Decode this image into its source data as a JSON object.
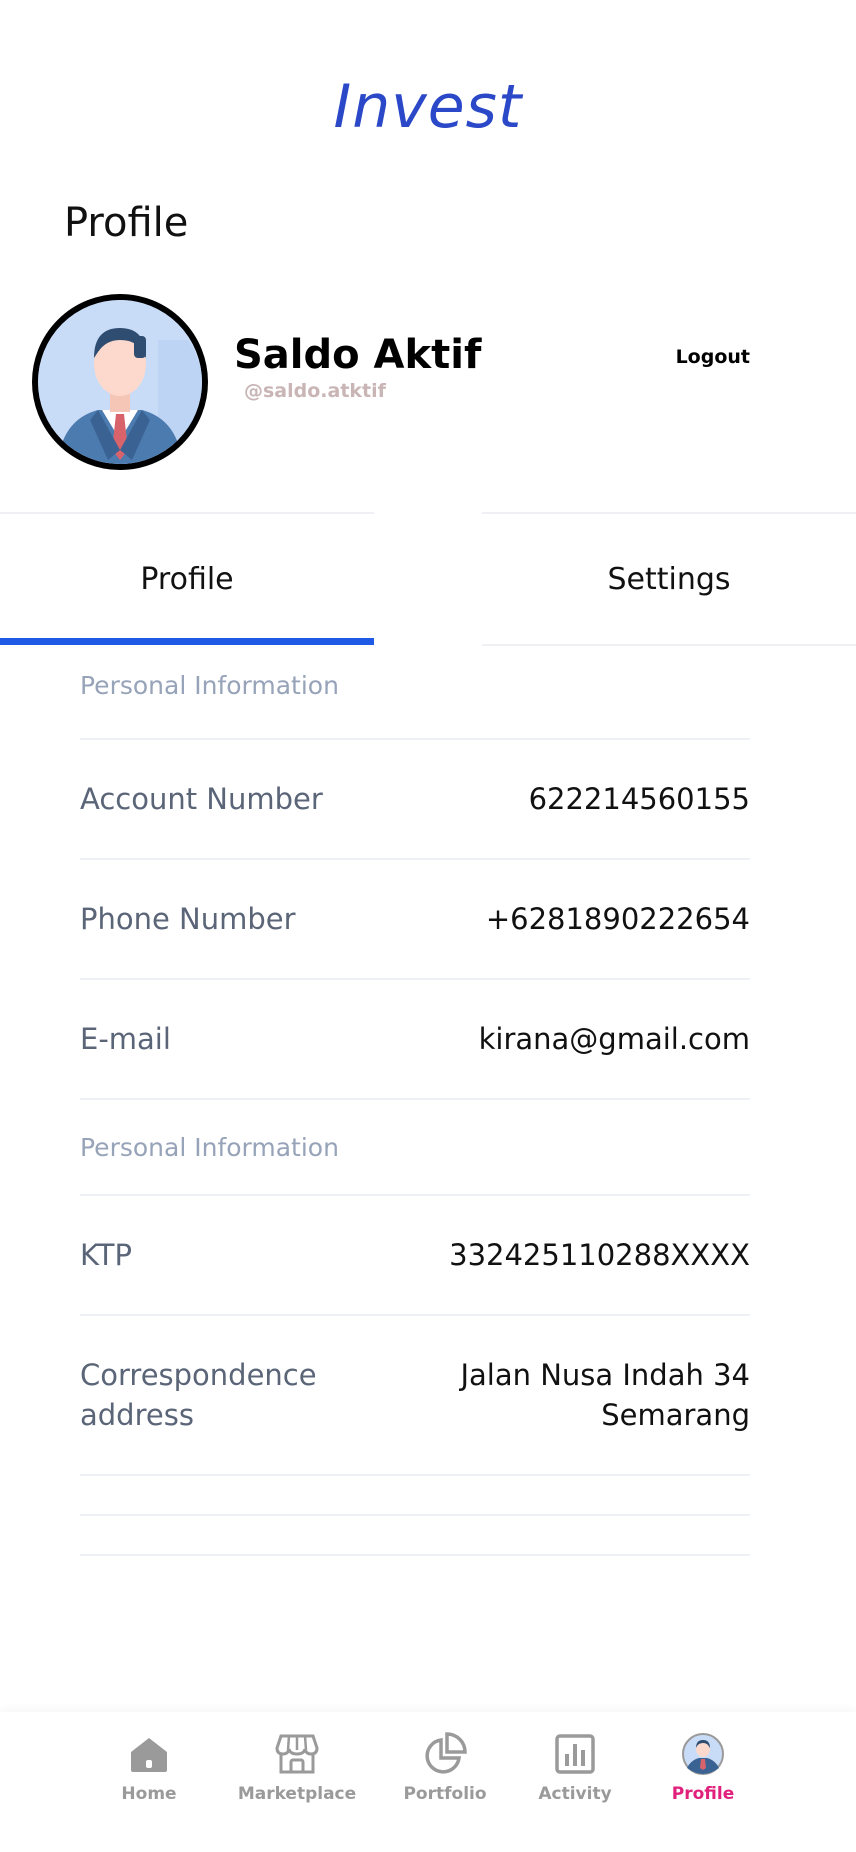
{
  "app": {
    "title": "Invest",
    "page_title": "Profile"
  },
  "user": {
    "name": "Saldo Aktif",
    "handle": "@saldo.atktif",
    "logout_label": "Logout"
  },
  "tabs": [
    {
      "label": "Profile",
      "active": true
    },
    {
      "label": "Settings",
      "active": false
    }
  ],
  "sections": {
    "personal_1": {
      "header": "Personal Information",
      "rows": [
        {
          "label": "Account Number",
          "value": "622214560155"
        },
        {
          "label": "Phone Number",
          "value": "+6281890222654"
        },
        {
          "label": "E-mail",
          "value": "kirana@gmail.com"
        }
      ]
    },
    "personal_2": {
      "header": "Personal Information",
      "rows": [
        {
          "label": "KTP",
          "value": "332425110288XXXX"
        },
        {
          "label": "Correspondence address",
          "value": "Jalan Nusa Indah 34 Semarang"
        }
      ]
    }
  },
  "bottom_nav": [
    {
      "label": "Home",
      "icon": "home-icon",
      "active": false
    },
    {
      "label": "Marketplace",
      "icon": "marketplace-icon",
      "active": false
    },
    {
      "label": "Portfolio",
      "icon": "portfolio-icon",
      "active": false
    },
    {
      "label": "Activity",
      "icon": "activity-icon",
      "active": false
    },
    {
      "label": "Profile",
      "icon": "profile-avatar-icon",
      "active": true
    }
  ],
  "colors": {
    "brand_blue": "#2b48c8",
    "tab_indicator": "#1f5ae6",
    "active_nav": "#e0207b",
    "inactive_nav": "#9a9a9a"
  }
}
